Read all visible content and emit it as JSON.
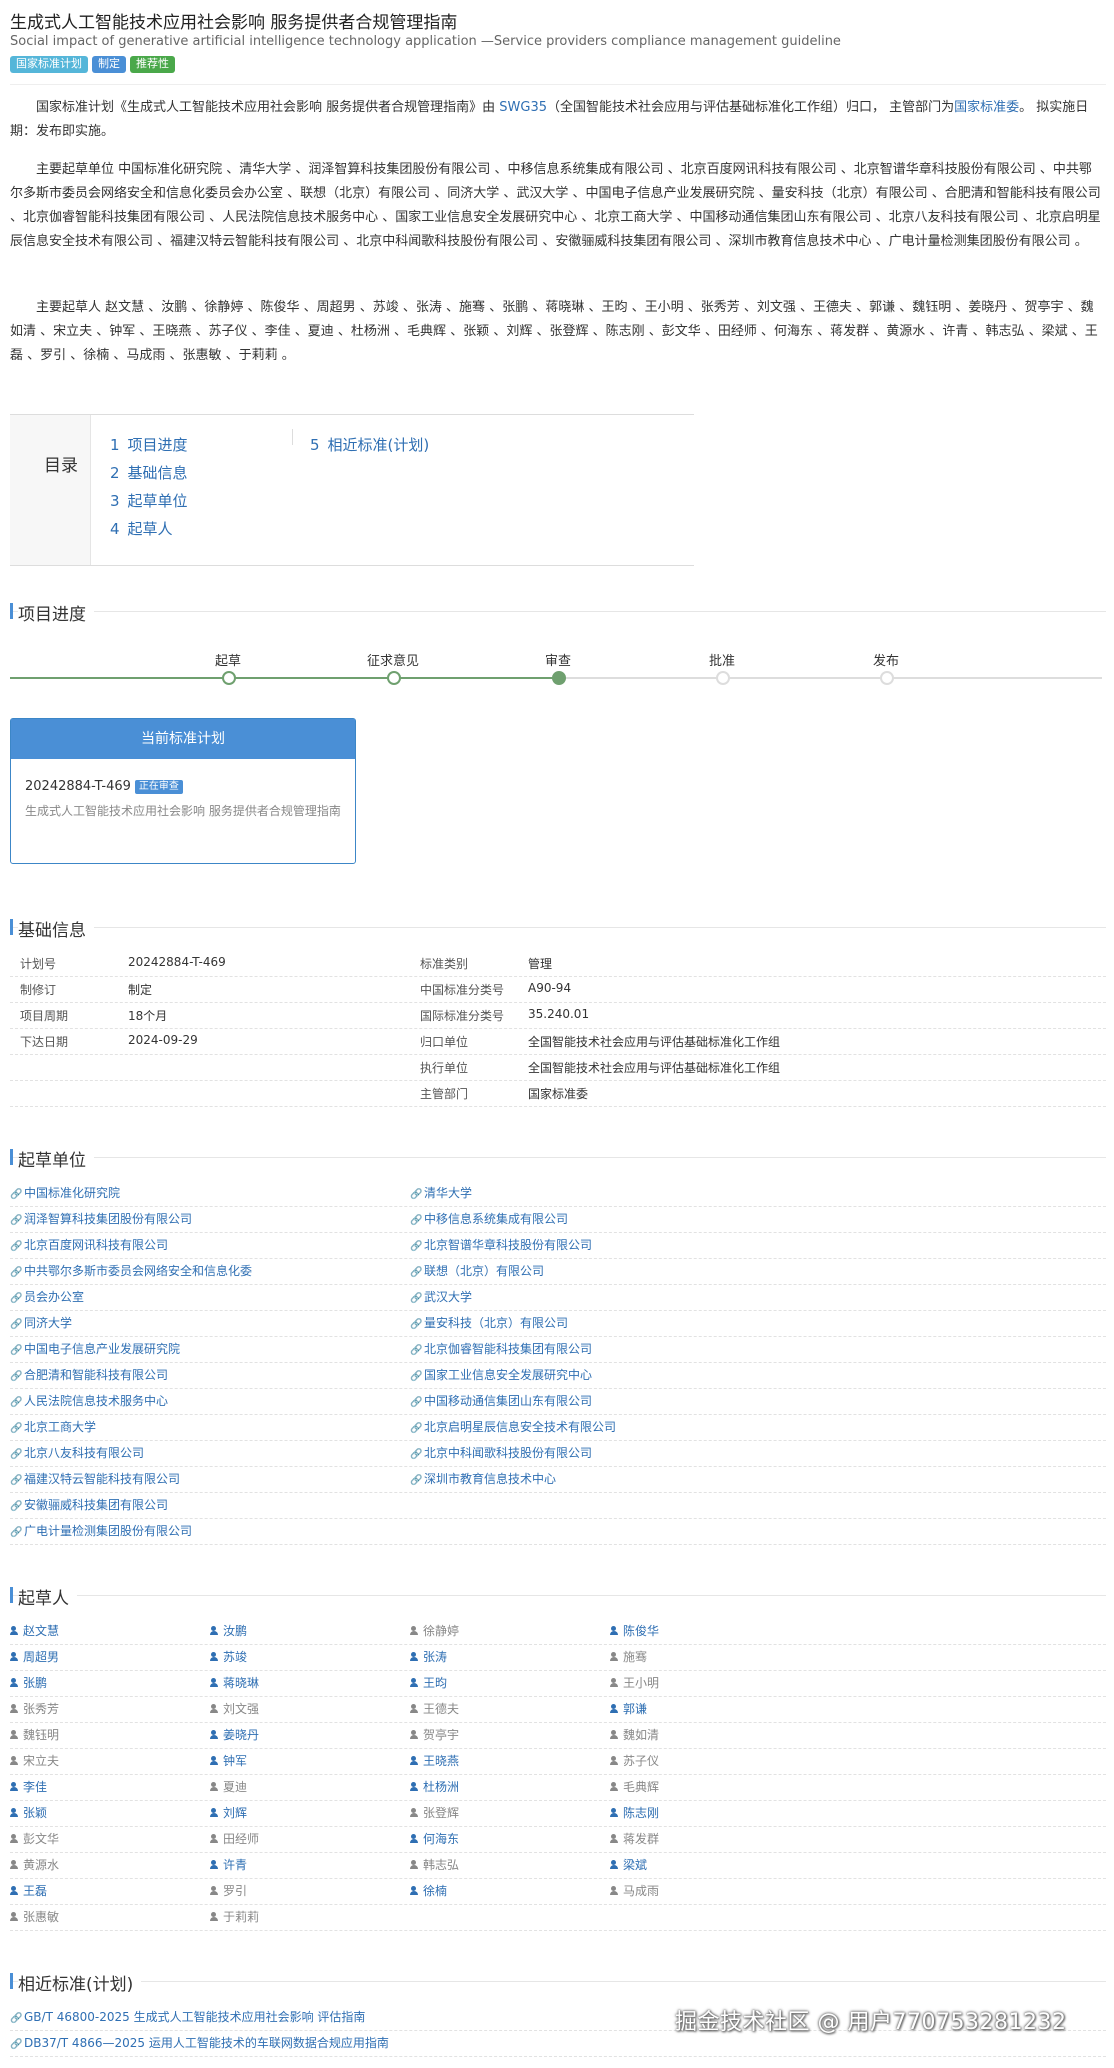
{
  "header": {
    "title": "生成式人工智能技术应用社会影响 服务提供者合规管理指南",
    "subtitle": "Social impact of generative artificial intelligence technology application —Service providers compliance management guideline",
    "badges": [
      "国家标准计划",
      "制定",
      "推荐性"
    ]
  },
  "intro": {
    "p1_a": "国家标准计划《生成式人工智能技术应用社会影响 服务提供者合规管理指南》由 ",
    "p1_link1": "SWG35",
    "p1_b": "（全国智能技术社会应用与评估基础标准化工作组）归口， 主管部门为",
    "p1_link2": "国家标准委",
    "p1_c": "。 拟实施日期：发布即实施。",
    "p2": "主要起草单位 中国标准化研究院 、清华大学 、润泽智算科技集团股份有限公司 、中移信息系统集成有限公司 、北京百度网讯科技有限公司 、北京智谱华章科技股份有限公司 、中共鄂尔多斯市委员会网络安全和信息化委员会办公室 、联想（北京）有限公司 、同济大学 、武汉大学 、中国电子信息产业发展研究院 、量安科技（北京）有限公司 、合肥清和智能科技有限公司 、北京伽睿智能科技集团有限公司 、人民法院信息技术服务中心 、国家工业信息安全发展研究中心 、北京工商大学 、中国移动通信集团山东有限公司 、北京八友科技有限公司 、北京启明星辰信息安全技术有限公司 、福建汉特云智能科技有限公司 、北京中科闻歌科技股份有限公司 、安徽骊威科技集团有限公司 、深圳市教育信息技术中心 、广电计量检测集团股份有限公司 。",
    "p3": "主要起草人 赵文慧 、汝鹏 、徐静婷 、陈俊华 、周超男 、苏竣 、张涛 、施骞 、张鹏 、蒋晓琳 、王昀 、王小明 、张秀芳 、刘文强 、王德夫 、郭谦 、魏钰明 、姜晓丹 、贺亭宇 、魏如清 、宋立夫 、钟军 、王晓燕 、苏子仪 、李佳 、夏迪 、杜杨洲 、毛典辉 、张颖 、刘辉 、张登辉 、陈志刚 、彭文华 、田经师 、何海东 、蒋发群 、黄源水 、许青 、韩志弘 、梁斌 、王磊 、罗引 、徐楠 、马成雨 、张惠敏 、于莉莉 。"
  },
  "toc": {
    "label": "目录",
    "items": [
      {
        "num": "1",
        "label": "项目进度"
      },
      {
        "num": "2",
        "label": "基础信息"
      },
      {
        "num": "3",
        "label": "起草单位"
      },
      {
        "num": "4",
        "label": "起草人"
      },
      {
        "num": "5",
        "label": "相近标准(计划)"
      }
    ]
  },
  "sections": {
    "progress": "项目进度",
    "basic": "基础信息",
    "units": "起草单位",
    "people": "起草人",
    "similar": "相近标准(计划)"
  },
  "progress": {
    "steps": [
      "起草",
      "征求意见",
      "审查",
      "批准",
      "发布"
    ],
    "current_index": 2
  },
  "plan_card": {
    "title": "当前标准计划",
    "code": "20242884-T-469",
    "status": "正在审查",
    "desc": "生成式人工智能技术应用社会影响 服务提供者合规管理指南"
  },
  "basic_info": {
    "left": [
      {
        "k": "计划号",
        "v": "20242884-T-469"
      },
      {
        "k": "制修订",
        "v": "制定"
      },
      {
        "k": "项目周期",
        "v": "18个月"
      },
      {
        "k": "下达日期",
        "v": "2024-09-29"
      }
    ],
    "right": [
      {
        "k": "标准类别",
        "v": "管理",
        "link": false
      },
      {
        "k": "中国标准分类号",
        "v": "A90-94",
        "link": false
      },
      {
        "k": "国际标准分类号",
        "v": "35.240.01",
        "link": false
      },
      {
        "k": "归口单位",
        "v": "全国智能技术社会应用与评估基础标准化工作组",
        "link": true
      },
      {
        "k": "执行单位",
        "v": "全国智能技术社会应用与评估基础标准化工作组",
        "link": true
      },
      {
        "k": "主管部门",
        "v": "国家标准委",
        "link": true
      }
    ]
  },
  "units": [
    [
      "中国标准化研究院",
      "清华大学"
    ],
    [
      "润泽智算科技集团股份有限公司",
      "中移信息系统集成有限公司"
    ],
    [
      "北京百度网讯科技有限公司",
      "北京智谱华章科技股份有限公司"
    ],
    [
      "中共鄂尔多斯市委员会网络安全和信息化委",
      "联想（北京）有限公司"
    ],
    [
      "员会办公室",
      "武汉大学"
    ],
    [
      "同济大学",
      "量安科技（北京）有限公司"
    ],
    [
      "中国电子信息产业发展研究院",
      "北京伽睿智能科技集团有限公司"
    ],
    [
      "合肥清和智能科技有限公司",
      "国家工业信息安全发展研究中心"
    ],
    [
      "人民法院信息技术服务中心",
      "中国移动通信集团山东有限公司"
    ],
    [
      "北京工商大学",
      "北京启明星辰信息安全技术有限公司"
    ],
    [
      "北京八友科技有限公司",
      "北京中科闻歌科技股份有限公司"
    ],
    [
      "福建汉特云智能科技有限公司",
      "深圳市教育信息技术中心"
    ],
    [
      "安徽骊威科技集团有限公司",
      ""
    ],
    [
      "广电计量检测集团股份有限公司",
      ""
    ]
  ],
  "people": [
    [
      {
        "n": "赵文慧",
        "on": true
      },
      {
        "n": "汝鹏",
        "on": true
      },
      {
        "n": "徐静婷",
        "on": false
      },
      {
        "n": "陈俊华",
        "on": true
      }
    ],
    [
      {
        "n": "周超男",
        "on": true
      },
      {
        "n": "苏竣",
        "on": true
      },
      {
        "n": "张涛",
        "on": true
      },
      {
        "n": "施骞",
        "on": false
      }
    ],
    [
      {
        "n": "张鹏",
        "on": true
      },
      {
        "n": "蒋晓琳",
        "on": true
      },
      {
        "n": "王昀",
        "on": true
      },
      {
        "n": "王小明",
        "on": false
      }
    ],
    [
      {
        "n": "张秀芳",
        "on": false
      },
      {
        "n": "刘文强",
        "on": false
      },
      {
        "n": "王德夫",
        "on": false
      },
      {
        "n": "郭谦",
        "on": true
      }
    ],
    [
      {
        "n": "魏钰明",
        "on": false
      },
      {
        "n": "姜晓丹",
        "on": true
      },
      {
        "n": "贺亭宇",
        "on": false
      },
      {
        "n": "魏如清",
        "on": false
      }
    ],
    [
      {
        "n": "宋立夫",
        "on": false
      },
      {
        "n": "钟军",
        "on": true
      },
      {
        "n": "王晓燕",
        "on": true
      },
      {
        "n": "苏子仪",
        "on": false
      }
    ],
    [
      {
        "n": "李佳",
        "on": true
      },
      {
        "n": "夏迪",
        "on": false
      },
      {
        "n": "杜杨洲",
        "on": true
      },
      {
        "n": "毛典辉",
        "on": false
      }
    ],
    [
      {
        "n": "张颖",
        "on": true
      },
      {
        "n": "刘辉",
        "on": true
      },
      {
        "n": "张登辉",
        "on": false
      },
      {
        "n": "陈志刚",
        "on": true
      }
    ],
    [
      {
        "n": "彭文华",
        "on": false
      },
      {
        "n": "田经师",
        "on": false
      },
      {
        "n": "何海东",
        "on": true
      },
      {
        "n": "蒋发群",
        "on": false
      }
    ],
    [
      {
        "n": "黄源水",
        "on": false
      },
      {
        "n": "许青",
        "on": true
      },
      {
        "n": "韩志弘",
        "on": false
      },
      {
        "n": "梁斌",
        "on": true
      }
    ],
    [
      {
        "n": "王磊",
        "on": true
      },
      {
        "n": "罗引",
        "on": false
      },
      {
        "n": "徐楠",
        "on": true
      },
      {
        "n": "马成雨",
        "on": false
      }
    ],
    [
      {
        "n": "张惠敏",
        "on": false
      },
      {
        "n": "于莉莉",
        "on": false
      }
    ]
  ],
  "similar": [
    "GB/T 46800-2025  生成式人工智能技术应用社会影响 评估指南",
    "DB37/T 4866—2025  运用人工智能技术的车联网数据合规应用指南"
  ],
  "watermark": "掘金技术社区 @ 用户770753281232",
  "colors": {
    "link": "#2f6fb3",
    "accent": "#4a8fd6",
    "progress": "#6fa06f",
    "green_badge": "#4aa84a",
    "cyan_badge": "#55b6d9"
  }
}
